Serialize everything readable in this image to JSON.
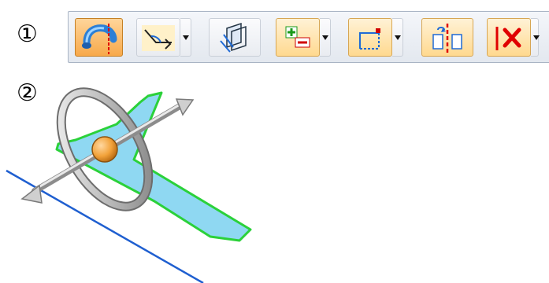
{
  "callouts": {
    "first": "①",
    "second": "②"
  },
  "toolbar": {
    "buttons": [
      {
        "icon": "pipe-bend-icon",
        "state": "active"
      },
      {
        "icon": "angle-dimension-icon",
        "state": "normal",
        "has_dropdown": true
      },
      {
        "icon": "sheet-flange-icon",
        "state": "normal"
      },
      {
        "icon": "add-remove-icon",
        "state": "warm",
        "has_dropdown": true
      },
      {
        "icon": "rectangle-corner-icon",
        "state": "warm",
        "has_dropdown": true
      },
      {
        "icon": "split-plane-icon",
        "state": "warm"
      },
      {
        "icon": "delete-face-icon",
        "state": "warm",
        "has_dropdown": true
      }
    ]
  },
  "colors": {
    "toolbar_bg": "#e7ebf1",
    "active_button": "#f7a94a",
    "warm_button": "#ffd98f",
    "face_fill": "#8fd8f2",
    "face_outline": "#2bd13a",
    "edge_line": "#1f5fd0",
    "handle_orange": "#f2a23a",
    "handle_gray": "#9a9a9a"
  }
}
